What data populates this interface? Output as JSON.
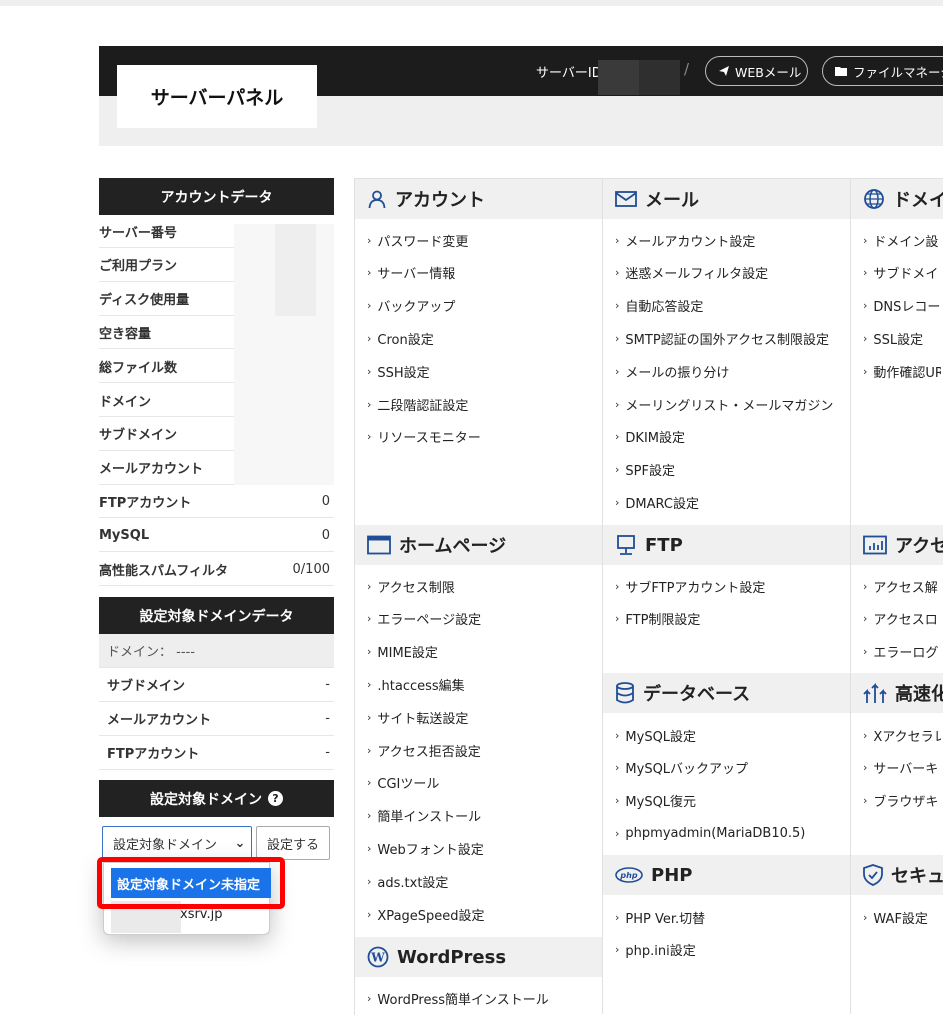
{
  "header": {
    "logo": "サーバーパネル",
    "server_id_label": "サーバーID",
    "separator": "/",
    "web_mail": "WEBメール",
    "file_manager": "ファイルマネージ"
  },
  "account_data": {
    "title": "アカウントデータ",
    "rows": [
      {
        "label": "サーバー番号",
        "value": ""
      },
      {
        "label": "ご利用プラン",
        "value": ""
      },
      {
        "label": "ディスク使用量",
        "value": ""
      },
      {
        "label": "空き容量",
        "value": ""
      },
      {
        "label": "総ファイル数",
        "value": ""
      },
      {
        "label": "ドメイン",
        "value": ""
      },
      {
        "label": "サブドメイン",
        "value": ""
      },
      {
        "label": "メールアカウント",
        "value": ""
      },
      {
        "label": "FTPアカウント",
        "value": "0"
      },
      {
        "label": "MySQL",
        "value": "0"
      },
      {
        "label": "高性能スパムフィルタ",
        "value": "0/100"
      }
    ]
  },
  "domain_data": {
    "title": "設定対象ドメインデータ",
    "domain_row": "ドメイン： ----",
    "rows": [
      {
        "label": "サブドメイン",
        "value": "-"
      },
      {
        "label": "メールアカウント",
        "value": "-"
      },
      {
        "label": "FTPアカウント",
        "value": "-"
      }
    ]
  },
  "target_domain": {
    "title": "設定対象ドメイン",
    "select_value": "設定対象ドメイン",
    "set_button": "設定する",
    "options": [
      "設定対象ドメイン未指定",
      "xsrv.jp"
    ]
  },
  "sections": {
    "account": {
      "title": "アカウント",
      "items": [
        "パスワード変更",
        "サーバー情報",
        "バックアップ",
        "Cron設定",
        "SSH設定",
        "二段階認証設定",
        "リソースモニター"
      ]
    },
    "mail": {
      "title": "メール",
      "items": [
        "メールアカウント設定",
        "迷惑メールフィルタ設定",
        "自動応答設定",
        "SMTP認証の国外アクセス制限設定",
        "メールの振り分け",
        "メーリングリスト・メールマガジン",
        "DKIM設定",
        "SPF設定",
        "DMARC設定"
      ]
    },
    "domain": {
      "title": "ドメイ",
      "items": [
        "ドメイン設",
        "サブドメイ",
        "DNSレコー",
        "SSL設定",
        "動作確認UR"
      ]
    },
    "homepage": {
      "title": "ホームページ",
      "items": [
        "アクセス制限",
        "エラーページ設定",
        "MIME設定",
        ".htaccess編集",
        "サイト転送設定",
        "アクセス拒否設定",
        "CGIツール",
        "簡単インストール",
        "Webフォント設定",
        "ads.txt設定",
        "XPageSpeed設定"
      ]
    },
    "ftp": {
      "title": "FTP",
      "items": [
        "サブFTPアカウント設定",
        "FTP制限設定"
      ]
    },
    "access": {
      "title": "アクセ",
      "items": [
        "アクセス解",
        "アクセスロ",
        "エラーログ"
      ]
    },
    "database": {
      "title": "データベース",
      "items": [
        "MySQL設定",
        "MySQLバックアップ",
        "MySQL復元",
        "phpmyadmin(MariaDB10.5)"
      ]
    },
    "speed": {
      "title": "高速化",
      "items": [
        "Xアクセラレ",
        "サーバーキ",
        "ブラウザキ"
      ]
    },
    "php": {
      "title": "PHP",
      "items": [
        "PHP Ver.切替",
        "php.ini設定"
      ]
    },
    "security": {
      "title": "セキュ",
      "items": [
        "WAF設定"
      ]
    },
    "wordpress": {
      "title": "WordPress",
      "items": [
        "WordPress簡単インストール"
      ]
    }
  },
  "colors": {
    "header_bg": "#1c1c1c",
    "accent_blue": "#1a73e8",
    "highlight_red": "#ff0000",
    "icon_blue": "#1f4e96"
  }
}
